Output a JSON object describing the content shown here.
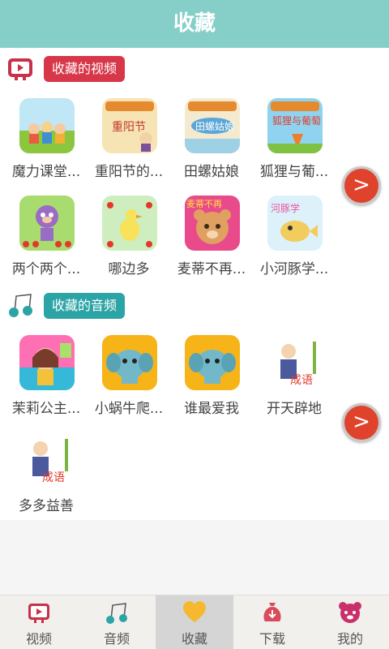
{
  "header": {
    "title": "收藏"
  },
  "video_section": {
    "label": "收藏的视频",
    "items": [
      {
        "title": "魔力课堂..."
      },
      {
        "title": "重阳节的..."
      },
      {
        "title": "田螺姑娘"
      },
      {
        "title": "狐狸与葡..."
      },
      {
        "title": "两个两个..."
      },
      {
        "title": "哪边多"
      },
      {
        "title": "麦蒂不再..."
      },
      {
        "title": "小河豚学..."
      }
    ],
    "next": ">"
  },
  "audio_section": {
    "label": "收藏的音频",
    "items": [
      {
        "title": "茉莉公主..."
      },
      {
        "title": "小蜗牛爬..."
      },
      {
        "title": "谁最爱我"
      },
      {
        "title": "开天辟地"
      },
      {
        "title": "多多益善"
      }
    ],
    "next": ">"
  },
  "tabs": [
    {
      "label": "视频",
      "icon": "tv-icon"
    },
    {
      "label": "音频",
      "icon": "music-note-icon"
    },
    {
      "label": "收藏",
      "icon": "heart-icon",
      "active": true
    },
    {
      "label": "下载",
      "icon": "download-bag-icon"
    },
    {
      "label": "我的",
      "icon": "bear-face-icon"
    }
  ],
  "colors": {
    "header": "#86cfc9",
    "video_label": "#d8374a",
    "audio_label": "#2ca4a6",
    "arrow": "#e0432c"
  }
}
